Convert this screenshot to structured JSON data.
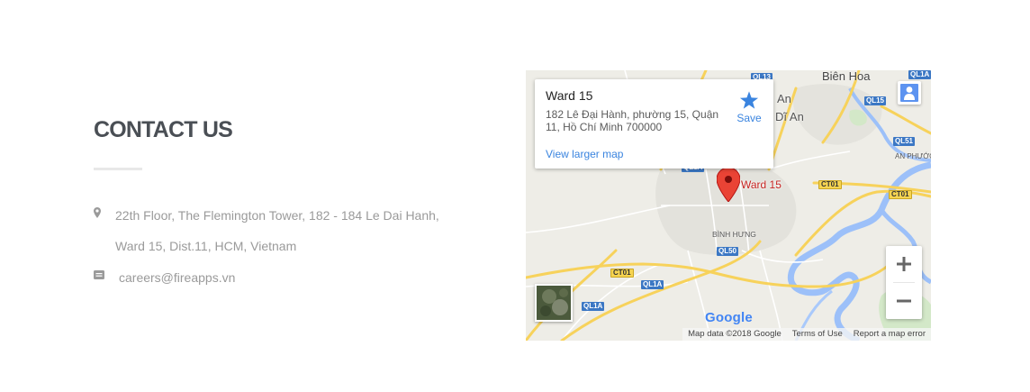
{
  "contact": {
    "title": "CONTACT US",
    "address_line1": "22th Floor, The Flemington Tower, 182 - 184 Le Dai Hanh,",
    "address_line2": "Ward 15, Dist.11, HCM, Vietnam",
    "email": "careers@fireapps.vn",
    "icons": {
      "address": "map-marker-icon",
      "email": "envelope-icon"
    }
  },
  "map": {
    "card": {
      "title": "Ward 15",
      "address": "182 Lê Đại Hành, phường 15, Quận 11, Hồ Chí Minh 700000",
      "link": "View larger map",
      "save_label": "Save"
    },
    "marker_label": "Ward 15",
    "places": {
      "bien_hoa": "Biên Hoa",
      "an": "An",
      "di_an": "Dĩ An",
      "an_phuoc": "AN PHƯỚC",
      "binh_hung": "BÌNH HƯNG"
    },
    "shields": {
      "ql13": "QL13",
      "ql1a_top": "QL1A",
      "ql15": "QL15",
      "ql51": "QL51",
      "ql1a_mid": "QL1A",
      "ct01_a": "CT01",
      "ct01_b": "CT01",
      "ql50": "QL50",
      "ct01_c": "CT01",
      "ql1a_low": "QL1A",
      "ql1a_bottom": "QL1A"
    },
    "google_logo": "Google",
    "attribution": {
      "map_data": "Map data ©2018 Google",
      "terms": "Terms of Use",
      "report": "Report a map error"
    },
    "colors": {
      "link": "#3a84df",
      "marker": "#c5221f",
      "highway": "#f7d25b",
      "water": "#8ab4f8",
      "land": "#eeede7"
    }
  }
}
